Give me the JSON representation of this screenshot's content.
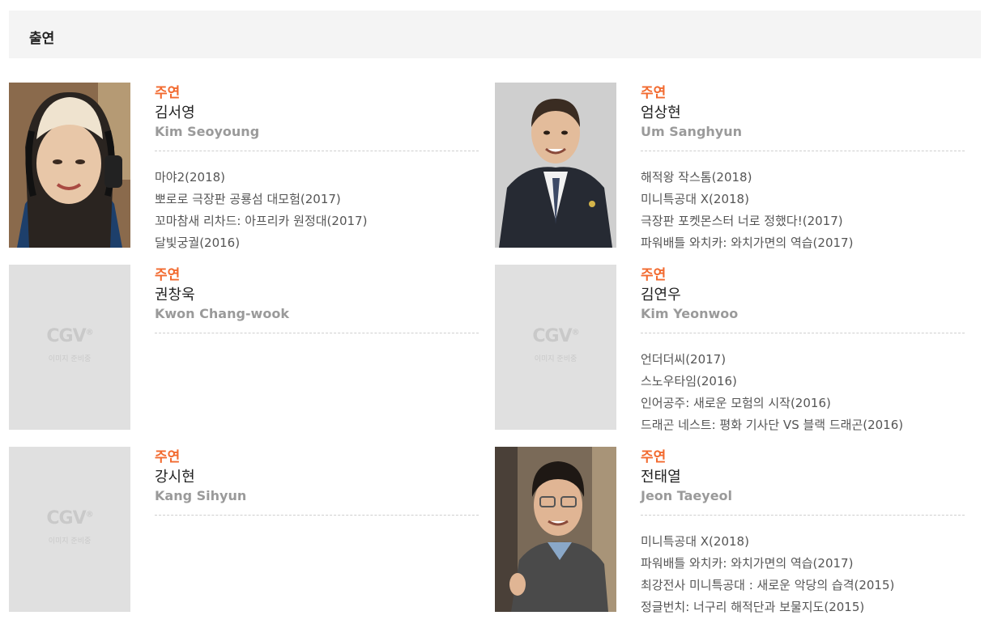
{
  "section": {
    "title": "출연"
  },
  "placeholder": {
    "logo": "CGV",
    "text": "이미지 준비중"
  },
  "cast": [
    {
      "role": "주연",
      "name_ko": "김서영",
      "name_en": "Kim Seoyoung",
      "photo": "photo",
      "films": [
        "마야2(2018)",
        "뽀로로 극장판 공룡섬 대모험(2017)",
        "꼬마참새 리차드: 아프리카 원정대(2017)",
        "달빛궁궐(2016)"
      ]
    },
    {
      "role": "주연",
      "name_ko": "엄상현",
      "name_en": "Um Sanghyun",
      "photo": "photo",
      "films": [
        "해적왕 작스톰(2018)",
        "미니특공대 X(2018)",
        "극장판 포켓몬스터 너로 정했다!(2017)",
        "파워배틀 와치카: 와치가면의 역습(2017)"
      ]
    },
    {
      "role": "주연",
      "name_ko": "권창욱",
      "name_en": "Kwon Chang-wook",
      "photo": "placeholder",
      "films": []
    },
    {
      "role": "주연",
      "name_ko": "김연우",
      "name_en": "Kim Yeonwoo",
      "photo": "placeholder",
      "films": [
        "언더더씨(2017)",
        "스노우타임(2016)",
        "인어공주: 새로운 모험의 시작(2016)",
        "드래곤 네스트: 평화 기사단 VS 블랙 드래곤(2016)"
      ]
    },
    {
      "role": "주연",
      "name_ko": "강시현",
      "name_en": "Kang Sihyun",
      "photo": "placeholder",
      "films": []
    },
    {
      "role": "주연",
      "name_ko": "전태열",
      "name_en": "Jeon Taeyeol",
      "photo": "photo",
      "films": [
        "미니특공대 X(2018)",
        "파워배틀 와치카: 와치가면의 역습(2017)",
        "최강전사 미니특공대 : 새로운 악당의 습격(2015)",
        "정글번치: 너구리 해적단과 보물지도(2015)"
      ]
    }
  ]
}
